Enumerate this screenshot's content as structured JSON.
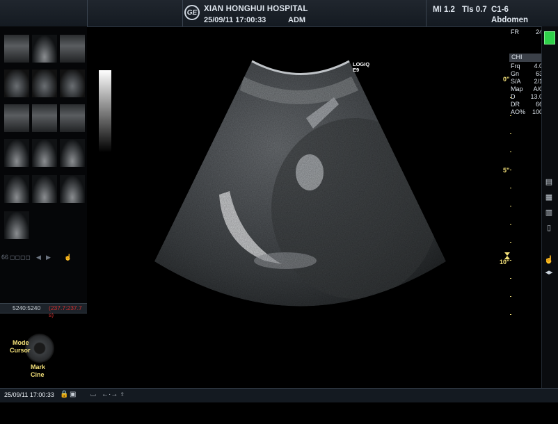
{
  "header": {
    "logo": "GE",
    "hospital": "XIAN HONGHUI HOSPITAL",
    "datetime": "25/09/11 17:00:33",
    "operator": "ADM",
    "mi": "MI 1.2",
    "tis": "TIs 0.7",
    "probe": "C1-6",
    "preset": "Abdomen"
  },
  "probe_label": [
    "LOGIQ",
    "E9"
  ],
  "params": [
    {
      "k": "FR",
      "v": "24"
    },
    {
      "k": "CHI",
      "v": ""
    },
    {
      "k": "Frq",
      "v": "4.0"
    },
    {
      "k": "Gn",
      "v": "63"
    },
    {
      "k": "S/A",
      "v": "2/1"
    },
    {
      "k": "Map",
      "v": "A/0"
    },
    {
      "k": "D",
      "v": "13.0"
    },
    {
      "k": "DR",
      "v": "66"
    },
    {
      "k": "AO%",
      "v": "100"
    }
  ],
  "depth_marks": [
    "0\"",
    "5\"",
    "10\""
  ],
  "segment": {
    "frames": "5240:5240",
    "time": "(237.7:237.7 s)"
  },
  "knob": {
    "top": "Mode",
    "top2": "Cursor",
    "bottom": "Mark",
    "bottom2": "Cine"
  },
  "tools_label": "66",
  "status_bar": {
    "datetime": "25/09/11 17:00:33"
  },
  "icons": [
    "lock-icon",
    "disk-icon",
    "caliper-icon",
    "arrows-icon",
    "probe-icon"
  ],
  "colors": {
    "accent": "#2fd14a",
    "marker": "#f5e27a",
    "alert": "#d03030"
  }
}
